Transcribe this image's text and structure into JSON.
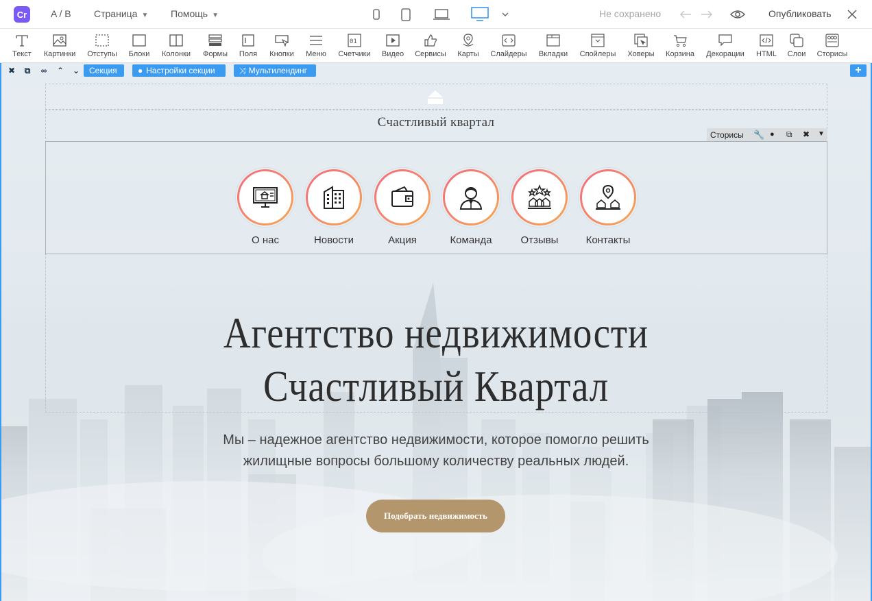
{
  "topbar": {
    "ab_label": "A / B",
    "page_menu": "Страница",
    "help_menu": "Помощь",
    "save_status": "Не сохранено",
    "publish_label": "Опубликовать"
  },
  "tools": [
    {
      "label": "Текст",
      "icon": "text-icon"
    },
    {
      "label": "Картинки",
      "icon": "image-icon"
    },
    {
      "label": "Отступы",
      "icon": "padding-icon"
    },
    {
      "label": "Блоки",
      "icon": "block-icon"
    },
    {
      "label": "Колонки",
      "icon": "columns-icon"
    },
    {
      "label": "Формы",
      "icon": "form-icon"
    },
    {
      "label": "Поля",
      "icon": "field-icon"
    },
    {
      "label": "Кнопки",
      "icon": "button-icon"
    },
    {
      "label": "Меню",
      "icon": "menu-icon"
    },
    {
      "label": "Счетчики",
      "icon": "counter-icon"
    },
    {
      "label": "Видео",
      "icon": "video-icon"
    },
    {
      "label": "Сервисы",
      "icon": "services-icon"
    },
    {
      "label": "Карты",
      "icon": "map-icon"
    },
    {
      "label": "Слайдеры",
      "icon": "slider-icon"
    },
    {
      "label": "Вкладки",
      "icon": "tabs-icon"
    },
    {
      "label": "Спойлеры",
      "icon": "spoiler-icon"
    },
    {
      "label": "Ховеры",
      "icon": "hover-icon"
    },
    {
      "label": "Корзина",
      "icon": "cart-icon"
    },
    {
      "label": "Декорации",
      "icon": "decor-icon"
    },
    {
      "label": "HTML",
      "icon": "html-icon"
    },
    {
      "label": "Слои",
      "icon": "layers-icon"
    },
    {
      "label": "Сторисы",
      "icon": "stories-icon"
    }
  ],
  "section_bar": {
    "section_label": "Секция",
    "settings_label": "Настройки секции",
    "multilanding_label": "Мультилендинг"
  },
  "site_name": "Счастливый квартал",
  "stories_tag": "Сторисы",
  "stories": [
    {
      "label": "О нас",
      "icon": "monitor-house-icon"
    },
    {
      "label": "Новости",
      "icon": "building-icon"
    },
    {
      "label": "Акция",
      "icon": "wallet-icon"
    },
    {
      "label": "Команда",
      "icon": "agent-icon"
    },
    {
      "label": "Отзывы",
      "icon": "stars-houses-icon"
    },
    {
      "label": "Контакты",
      "icon": "location-houses-icon"
    }
  ],
  "hero": {
    "title_line1": "Агентство недвижимости",
    "title_line2": "Счастливый Квартал",
    "sub_line1": "Мы – надежное агентство недвижимости, которое помогло решить",
    "sub_line2": "жилищные вопросы большому количеству реальных людей.",
    "cta_label": "Подобрать недвижимость"
  },
  "colors": {
    "accent_blue": "#3b9bf0",
    "cta_gold": "#b4966c",
    "logo_purple": "#7a5af5"
  }
}
